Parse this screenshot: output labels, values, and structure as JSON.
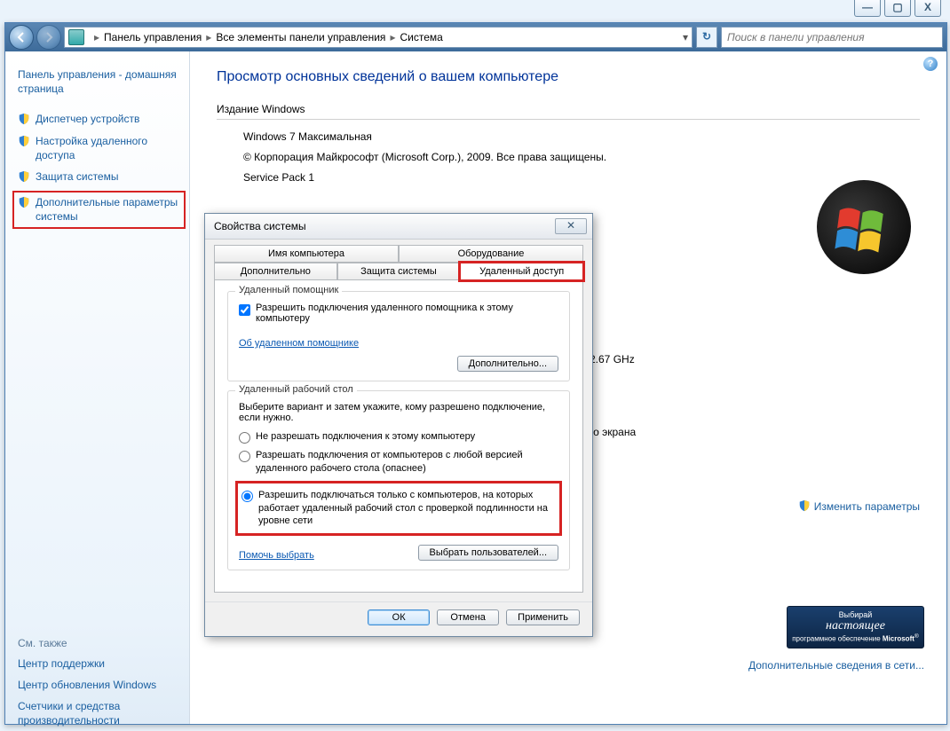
{
  "window_controls": {
    "min": "—",
    "max": "▢",
    "close": "X"
  },
  "breadcrumb": {
    "root": "Панель управления",
    "mid": "Все элементы панели управления",
    "leaf": "Система"
  },
  "search": {
    "placeholder": "Поиск в панели управления"
  },
  "sidebar": {
    "home": "Панель управления - домашняя страница",
    "items": [
      "Диспетчер устройств",
      "Настройка удаленного доступа",
      "Защита системы",
      "Дополнительные параметры системы"
    ],
    "see_also_title": "См. также",
    "see_also": [
      "Центр поддержки",
      "Центр обновления Windows",
      "Счетчики и средства производительности"
    ]
  },
  "main": {
    "heading": "Просмотр основных сведений о вашем компьютере",
    "edition_label": "Издание Windows",
    "edition_name": "Windows 7 Максимальная",
    "copyright": "© Корпорация Майкрософт (Microsoft Corp.), 2009. Все права защищены.",
    "sp": "Service Pack 1",
    "cpu_tail": "2.67 GHz",
    "screen_tail": "го экрана",
    "change_link": "Изменить параметры",
    "more_link": "Дополнительные сведения в сети..."
  },
  "badge": {
    "l1": "Выбирай",
    "l2": "настоящее",
    "l3": "программное обеспечение",
    "l4": "Microsoft"
  },
  "dialog": {
    "title": "Свойства системы",
    "tabs_row1": [
      "Имя компьютера",
      "Оборудование"
    ],
    "tabs_row2": [
      "Дополнительно",
      "Защита системы",
      "Удаленный доступ"
    ],
    "grp1_title": "Удаленный помощник",
    "chk_label": "Разрешить подключения удаленного помощника к этому компьютеру",
    "ra_link": "Об удаленном помощнике",
    "adv_btn": "Дополнительно...",
    "grp2_title": "Удаленный рабочий стол",
    "grp2_hint": "Выберите вариант и затем укажите, кому разрешено подключение, если нужно.",
    "r1": "Не разрешать подключения к этому компьютеру",
    "r2": "Разрешать подключения от компьютеров с любой версией удаленного рабочего стола (опаснее)",
    "r3": "Разрешить подключаться только с компьютеров, на которых работает удаленный рабочий стол с проверкой подлинности на уровне сети",
    "help_link": "Помочь выбрать",
    "sel_users": "Выбрать пользователей...",
    "ok": "ОК",
    "cancel": "Отмена",
    "apply": "Применить"
  }
}
